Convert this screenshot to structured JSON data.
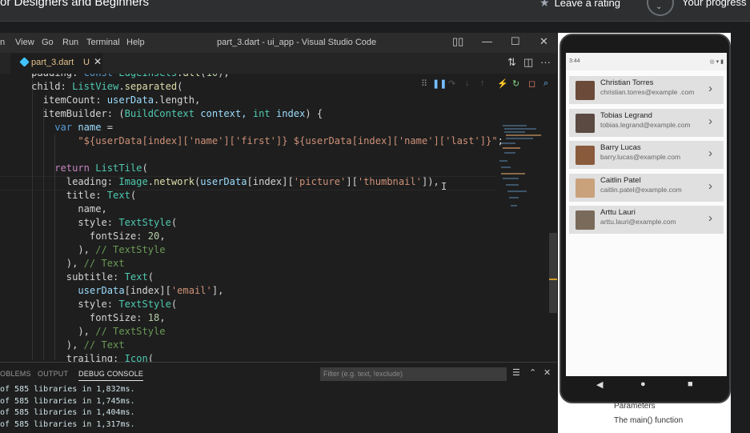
{
  "course": {
    "title": "or Designers and Beginners",
    "rating_label": "Leave a rating",
    "progress_label": "Your progress"
  },
  "vscode": {
    "menu": [
      "n",
      "View",
      "Go",
      "Run",
      "Terminal",
      "Help"
    ],
    "window_title": "part_3.dart - ui_app - Visual Studio Code",
    "tab": {
      "name": "part_3.dart",
      "badge": "U"
    }
  },
  "code": [
    [
      [
        "    padding: ",
        ""
      ],
      [
        "const ",
        "kw"
      ],
      [
        "EdgeInsets",
        "ty"
      ],
      [
        ".",
        ""
      ],
      [
        "all",
        "fn"
      ],
      [
        "(",
        ""
      ],
      [
        "10",
        "nm"
      ],
      [
        "),",
        ""
      ]
    ],
    [
      [
        "    child: ",
        ""
      ],
      [
        "ListView",
        "ty"
      ],
      [
        ".",
        ""
      ],
      [
        "separated",
        "fn"
      ],
      [
        "(",
        ""
      ]
    ],
    [
      [
        "      itemCount: ",
        ""
      ],
      [
        "userData",
        "vr"
      ],
      [
        ".length,",
        ""
      ]
    ],
    [
      [
        "      itemBuilder: (",
        ""
      ],
      [
        "BuildContext ",
        "ty"
      ],
      [
        "context, ",
        "vr"
      ],
      [
        "int ",
        "ty"
      ],
      [
        "index",
        "vr"
      ],
      [
        ") {",
        ""
      ]
    ],
    [
      [
        "        ",
        ""
      ],
      [
        "var ",
        "kw"
      ],
      [
        "name",
        "vr"
      ],
      [
        " =",
        ""
      ]
    ],
    [
      [
        "            ",
        ""
      ],
      [
        "\"${userData[index]['name']['first']} ${userData[index]['name']['last']}\"",
        "st"
      ],
      [
        ";",
        ""
      ]
    ],
    [
      [
        "",
        ""
      ]
    ],
    [
      [
        "        ",
        ""
      ],
      [
        "return ",
        "ct"
      ],
      [
        "ListTile",
        "ty"
      ],
      [
        "(",
        ""
      ]
    ],
    [
      [
        "          leading: ",
        ""
      ],
      [
        "Image",
        "ty"
      ],
      [
        ".",
        ""
      ],
      [
        "network",
        "fn"
      ],
      [
        "(",
        ""
      ],
      [
        "userData",
        "vr"
      ],
      [
        "[index][",
        ""
      ],
      [
        "'picture'",
        "st"
      ],
      [
        "][",
        ""
      ],
      [
        "'thumbnail'",
        "st"
      ],
      [
        "]),",
        ""
      ]
    ],
    [
      [
        "          title: ",
        ""
      ],
      [
        "Text",
        "ty"
      ],
      [
        "(",
        ""
      ]
    ],
    [
      [
        "            name,",
        ""
      ]
    ],
    [
      [
        "            style: ",
        ""
      ],
      [
        "TextStyle",
        "ty"
      ],
      [
        "(",
        ""
      ]
    ],
    [
      [
        "              fontSize: ",
        ""
      ],
      [
        "20",
        "nm"
      ],
      [
        ",",
        ""
      ]
    ],
    [
      [
        "            ), ",
        ""
      ],
      [
        "// TextStyle",
        "cm"
      ]
    ],
    [
      [
        "          ), ",
        ""
      ],
      [
        "// Text",
        "cm"
      ]
    ],
    [
      [
        "          subtitle: ",
        ""
      ],
      [
        "Text",
        "ty"
      ],
      [
        "(",
        ""
      ]
    ],
    [
      [
        "            ",
        ""
      ],
      [
        "userData",
        "vr"
      ],
      [
        "[index][",
        ""
      ],
      [
        "'email'",
        "st"
      ],
      [
        "],",
        ""
      ]
    ],
    [
      [
        "            style: ",
        ""
      ],
      [
        "TextStyle",
        "ty"
      ],
      [
        "(",
        ""
      ]
    ],
    [
      [
        "              fontSize: ",
        ""
      ],
      [
        "18",
        "nm"
      ],
      [
        ",",
        ""
      ]
    ],
    [
      [
        "            ), ",
        ""
      ],
      [
        "// TextStyle",
        "cm"
      ]
    ],
    [
      [
        "          ), ",
        ""
      ],
      [
        "// Text",
        "cm"
      ]
    ],
    [
      [
        "          trailing: ",
        ""
      ],
      [
        "Icon",
        "ty"
      ],
      [
        "(",
        ""
      ]
    ]
  ],
  "panel": {
    "tabs": [
      "OBLEMS",
      "OUTPUT",
      "DEBUG CONSOLE"
    ],
    "filter_placeholder": "Filter (e.g. text, !exclude)",
    "console": [
      "of 585 libraries in 1,832ms.",
      "of 585 libraries in 1,745ms.",
      "of 585 libraries in 1,404ms.",
      "of 585 libraries in 1,317ms."
    ]
  },
  "phone": {
    "status_time": "3:44",
    "users": [
      {
        "name": "Christian Torres",
        "email": "christian.torres@example .com",
        "color": "#6b4a3a"
      },
      {
        "name": "Tobias Legrand",
        "email": "tobias.legrand@example.com",
        "color": "#5a4a42"
      },
      {
        "name": "Barry Lucas",
        "email": "barry.lucas@example.com",
        "color": "#8a5a3c"
      },
      {
        "name": "Caitlin Patel",
        "email": "caitlin.patel@example.com",
        "color": "#c9a27c"
      },
      {
        "name": "Arttu Lauri",
        "email": "arttu.lauri@example.com",
        "color": "#7a6a5a"
      }
    ]
  },
  "outline": [
    "Parameters",
    "The main() function"
  ]
}
